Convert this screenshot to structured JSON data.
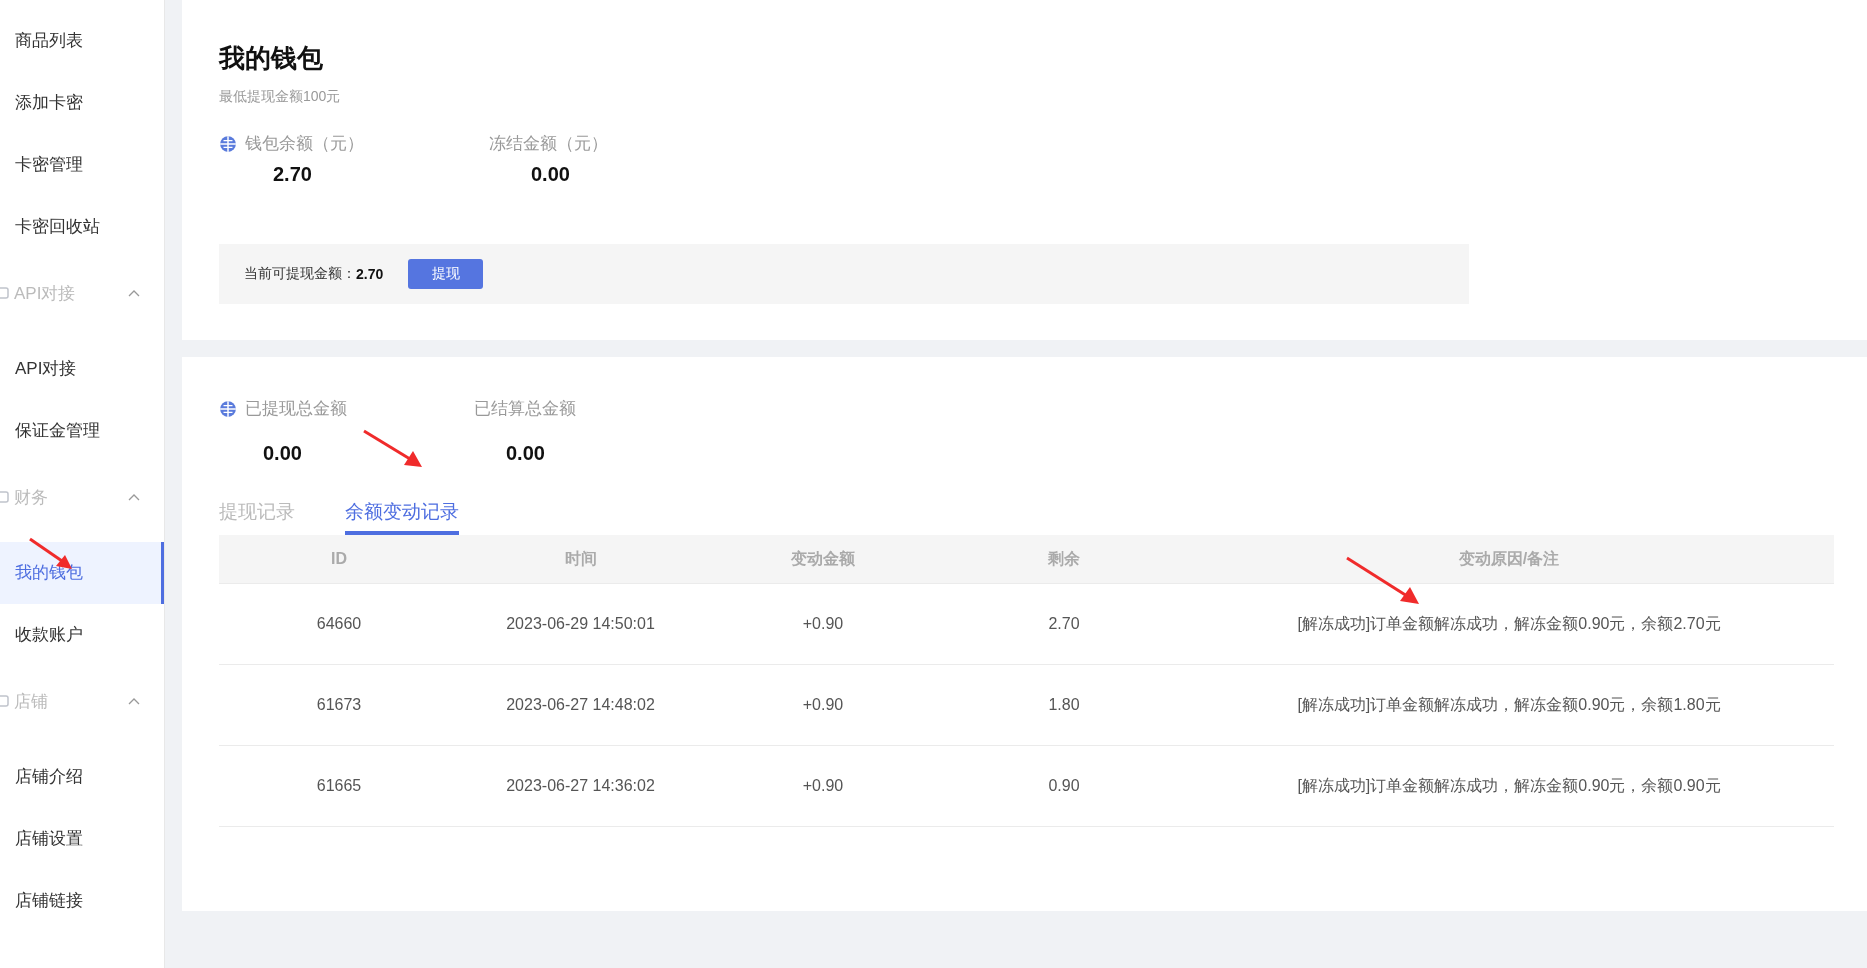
{
  "sidebar": {
    "items": [
      {
        "label": "商品列表",
        "selected": false
      },
      {
        "label": "添加卡密",
        "selected": false
      },
      {
        "label": "卡密管理",
        "selected": false
      },
      {
        "label": "卡密回收站",
        "selected": false
      },
      {
        "label": "API对接",
        "expanded": true,
        "children": [
          {
            "label": "API对接",
            "selected": false
          },
          {
            "label": "保证金管理",
            "selected": false
          }
        ]
      },
      {
        "label": "财务",
        "expanded": true,
        "children": [
          {
            "label": "我的钱包",
            "selected": true
          },
          {
            "label": "收款账户",
            "selected": false
          }
        ]
      },
      {
        "label": "店铺",
        "expanded": true,
        "children": [
          {
            "label": "店铺介绍",
            "selected": false
          },
          {
            "label": "店铺设置",
            "selected": false
          },
          {
            "label": "店铺链接",
            "selected": false
          }
        ]
      }
    ]
  },
  "wallet": {
    "title": "我的钱包",
    "subtitle": "最低提现金额100元",
    "stats": [
      {
        "label": "钱包余额（元）",
        "value": "2.70",
        "icon": true
      },
      {
        "label": "冻结金额（元）",
        "value": "0.00",
        "icon": false
      }
    ],
    "withdraw_bar": {
      "label": "当前可提现金额：",
      "amount": "2.70",
      "button": "提现"
    }
  },
  "records": {
    "stats": [
      {
        "label": "已提现总金额",
        "value": "0.00",
        "icon": true
      },
      {
        "label": "已结算总金额",
        "value": "0.00",
        "icon": false
      }
    ],
    "tabs": [
      {
        "label": "提现记录",
        "selected": false
      },
      {
        "label": "余额变动记录",
        "selected": true
      }
    ],
    "table": {
      "columns": [
        "ID",
        "时间",
        "变动金额",
        "剩余",
        "变动原因/备注"
      ],
      "rows": [
        [
          "64660",
          "2023-06-29 14:50:01",
          "+0.90",
          "2.70",
          "[解冻成功]订单金额解冻成功，解冻金额0.90元，余额2.70元"
        ],
        [
          "61673",
          "2023-06-27 14:48:02",
          "+0.90",
          "1.80",
          "[解冻成功]订单金额解冻成功，解冻金额0.90元，余额1.80元"
        ],
        [
          "61665",
          "2023-06-27 14:36:02",
          "+0.90",
          "0.90",
          "[解冻成功]订单金额解冻成功，解冻金额0.90元，余额0.90元"
        ]
      ]
    }
  }
}
